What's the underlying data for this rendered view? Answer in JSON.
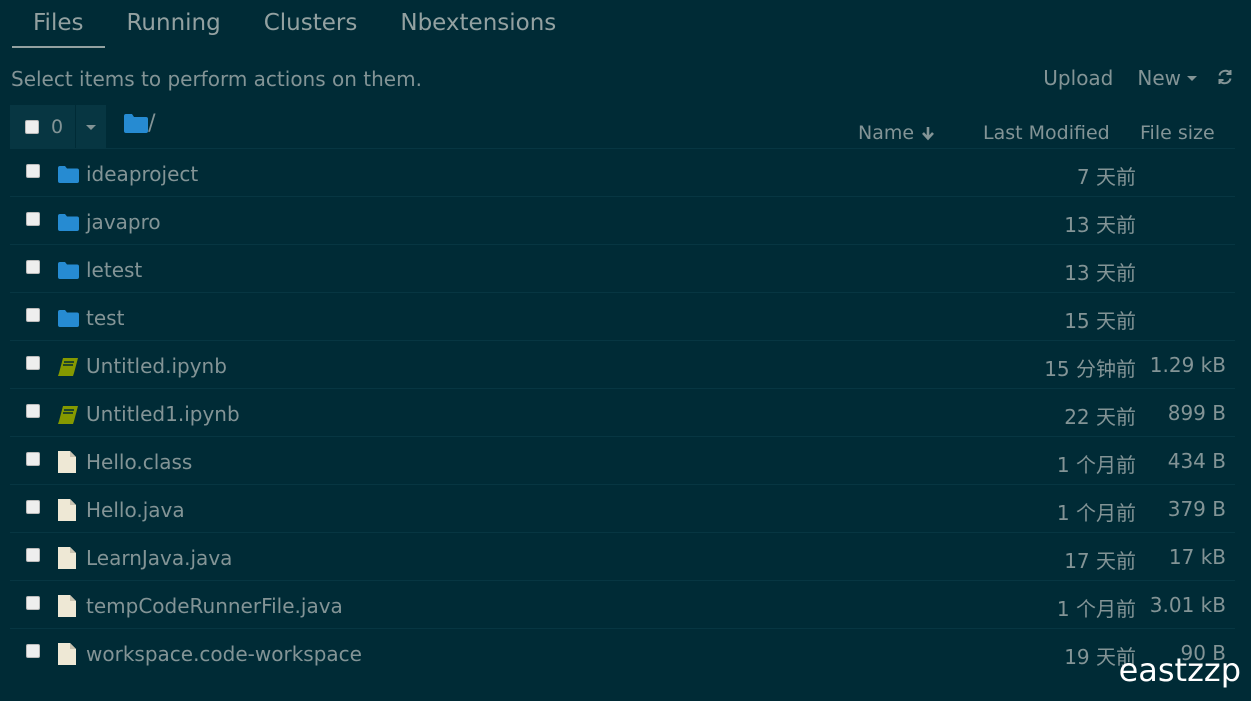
{
  "tabs": [
    "Files",
    "Running",
    "Clusters",
    "Nbextensions"
  ],
  "hint": "Select items to perform actions on them.",
  "actions": {
    "upload": "Upload",
    "new": "New"
  },
  "toolbar": {
    "selected_count": "0",
    "breadcrumb": "/"
  },
  "columns": {
    "name": "Name",
    "modified": "Last Modified",
    "size": "File size"
  },
  "files": [
    {
      "type": "folder",
      "name": "ideaproject",
      "modified": "7 天前",
      "size": ""
    },
    {
      "type": "folder",
      "name": "javapro",
      "modified": "13 天前",
      "size": ""
    },
    {
      "type": "folder",
      "name": "letest",
      "modified": "13 天前",
      "size": ""
    },
    {
      "type": "folder",
      "name": "test",
      "modified": "15 天前",
      "size": ""
    },
    {
      "type": "notebook",
      "name": "Untitled.ipynb",
      "modified": "15 分钟前",
      "size": "1.29 kB"
    },
    {
      "type": "notebook",
      "name": "Untitled1.ipynb",
      "modified": "22 天前",
      "size": "899 B"
    },
    {
      "type": "file",
      "name": "Hello.class",
      "modified": "1 个月前",
      "size": "434 B"
    },
    {
      "type": "file",
      "name": "Hello.java",
      "modified": "1 个月前",
      "size": "379 B"
    },
    {
      "type": "file",
      "name": "LearnJava.java",
      "modified": "17 天前",
      "size": "17 kB"
    },
    {
      "type": "file",
      "name": "tempCodeRunnerFile.java",
      "modified": "1 个月前",
      "size": "3.01 kB"
    },
    {
      "type": "file",
      "name": "workspace.code-workspace",
      "modified": "19 天前",
      "size": "90 B"
    }
  ],
  "watermark": "eastzzp",
  "colors": {
    "background": "#002b36",
    "text": "#839496",
    "folder": "#268bd2",
    "notebook": "#859900"
  }
}
